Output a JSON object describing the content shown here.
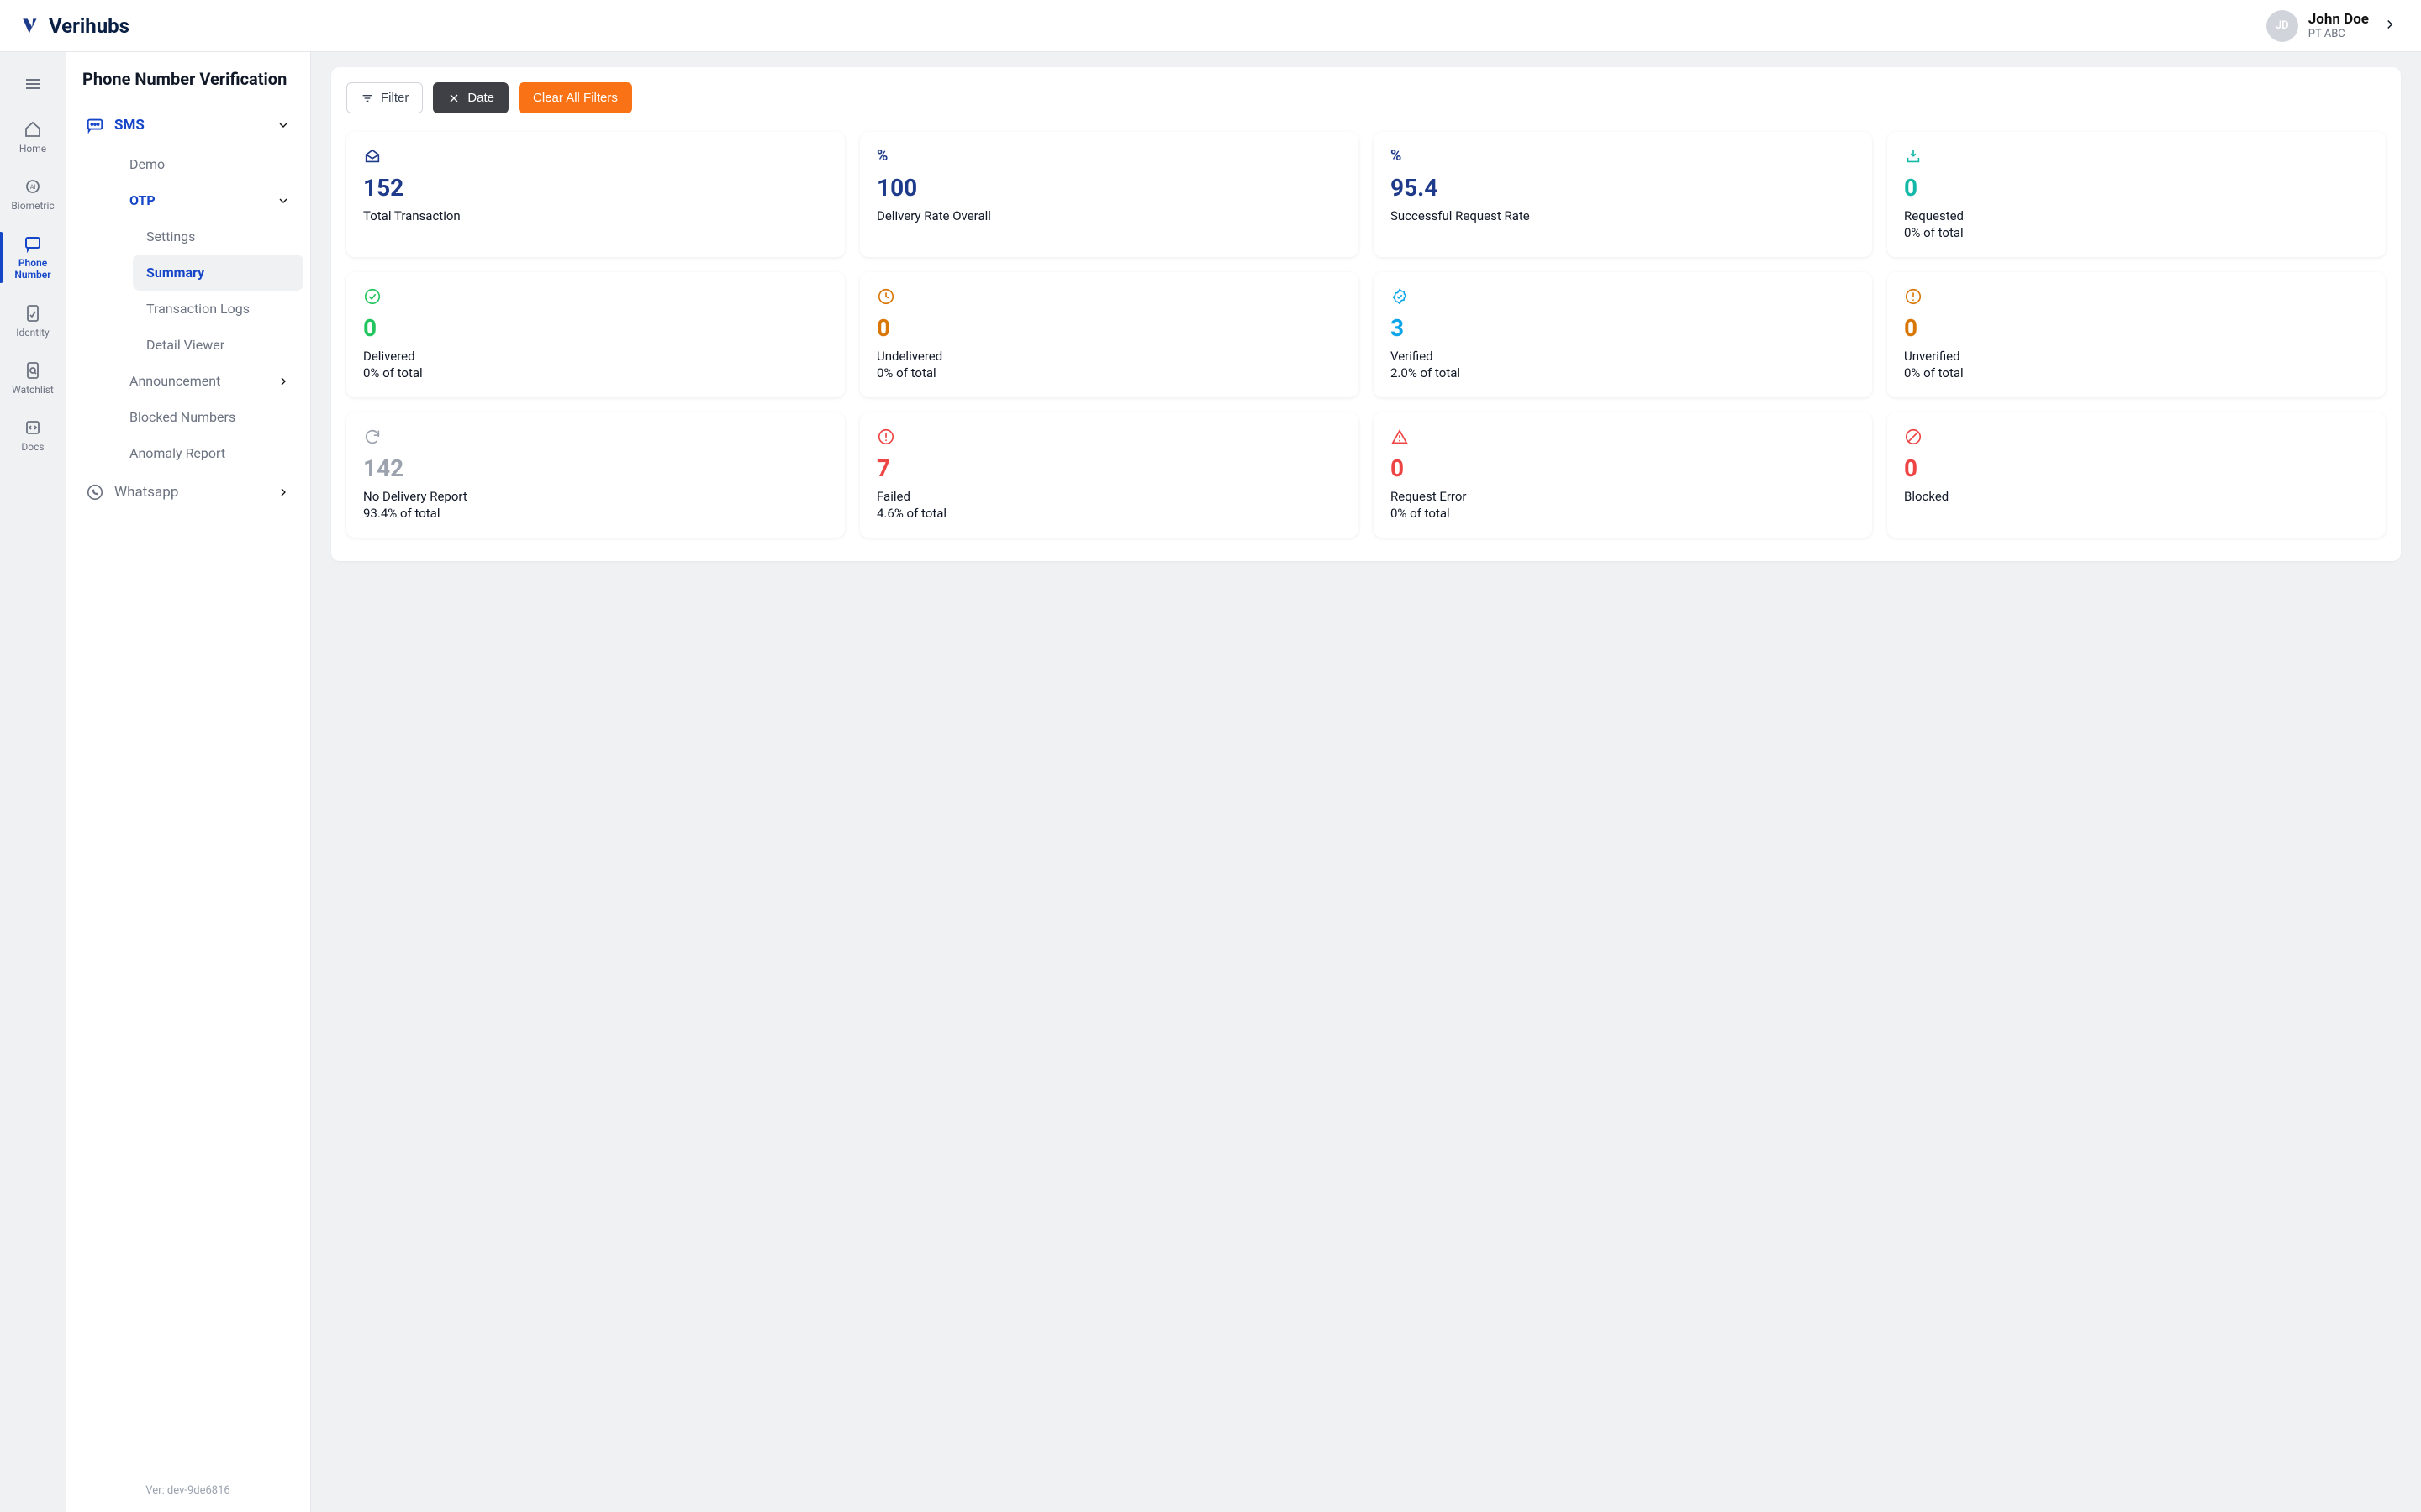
{
  "brand": "Verihubs",
  "user": {
    "initials": "JD",
    "name": "John Doe",
    "org": "PT ABC"
  },
  "rail": {
    "items": [
      {
        "id": "home",
        "label": "Home"
      },
      {
        "id": "biometric",
        "label": "Biometric"
      },
      {
        "id": "phone",
        "label": "Phone Number",
        "active": true
      },
      {
        "id": "identity",
        "label": "Identity"
      },
      {
        "id": "watchlist",
        "label": "Watchlist"
      },
      {
        "id": "docs",
        "label": "Docs"
      }
    ]
  },
  "sidebar": {
    "title": "Phone Number Verification",
    "sms": {
      "label": "SMS"
    },
    "demo": {
      "label": "Demo"
    },
    "otp": {
      "label": "OTP",
      "children": {
        "settings": "Settings",
        "summary": "Summary",
        "txlogs": "Transaction Logs",
        "detail": "Detail Viewer"
      }
    },
    "announcement": {
      "label": "Announcement"
    },
    "blocked": {
      "label": "Blocked Numbers"
    },
    "anomaly": {
      "label": "Anomaly Report"
    },
    "whatsapp": {
      "label": "Whatsapp"
    },
    "version": "Ver: dev-9de6816"
  },
  "filters": {
    "filter": "Filter",
    "date": "Date",
    "clear": "Clear All Filters"
  },
  "cards": {
    "total": {
      "value": "152",
      "label": "Total Transaction"
    },
    "delivery": {
      "value": "100",
      "label": "Delivery Rate Overall"
    },
    "success": {
      "value": "95.4",
      "label": "Successful Request Rate"
    },
    "requested": {
      "value": "0",
      "label": "Requested",
      "sub": "0% of total"
    },
    "delivered": {
      "value": "0",
      "label": "Delivered",
      "sub": "0% of total"
    },
    "undelivered": {
      "value": "0",
      "label": "Undelivered",
      "sub": "0% of total"
    },
    "verified": {
      "value": "3",
      "label": "Verified",
      "sub": "2.0% of total"
    },
    "unverified": {
      "value": "0",
      "label": "Unverified",
      "sub": "0% of total"
    },
    "nodr": {
      "value": "142",
      "label": "No Delivery Report",
      "sub": "93.4% of total"
    },
    "failed": {
      "value": "7",
      "label": "Failed",
      "sub": "4.6% of total"
    },
    "reqerr": {
      "value": "0",
      "label": "Request Error",
      "sub": "0% of total"
    },
    "blocked": {
      "value": "0",
      "label": "Blocked"
    }
  }
}
